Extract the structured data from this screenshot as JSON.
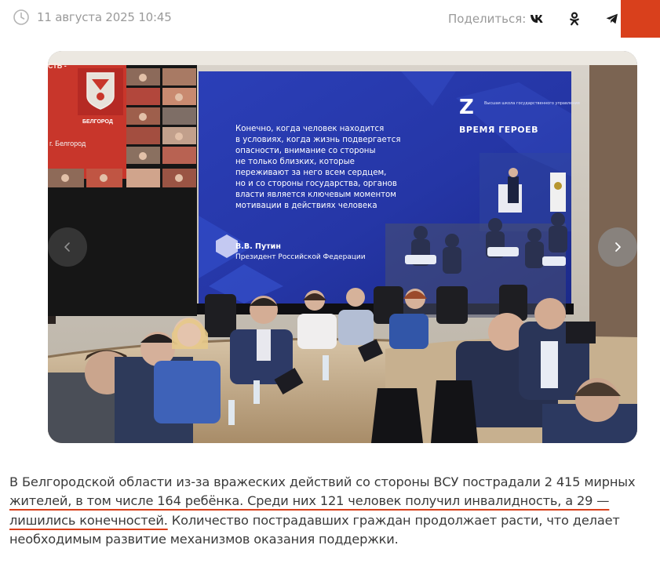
{
  "meta": {
    "date": "11 августа 2025 10:45",
    "share_label": "Поделиться:"
  },
  "share": {
    "buttons": [
      {
        "name": "vk-icon",
        "network": "VK"
      },
      {
        "name": "odnoklassniki-icon",
        "network": "OK"
      },
      {
        "name": "telegram-icon",
        "network": "Telegram"
      }
    ],
    "accent_color": "#d9401c"
  },
  "photo": {
    "screen": {
      "quote_lines": [
        "Конечно, когда человек находится",
        "в условиях, когда жизнь подвергается",
        "опасности, внимание со стороны",
        "не только близких, которые",
        "переживают за него всем сердцем,",
        "но и со стороны государства, органов",
        "власти является ключевым моментом",
        "мотивации в действиях человека"
      ],
      "author_name": "В.В. Путин",
      "author_title": "Президент Российской Федерации",
      "program_title": "ВРЕМЯ ГЕРОЕВ",
      "program_subtitle": "Высшая школа государственного управления",
      "left_panel_label": "г. Белгород",
      "left_panel_brand": "БЕЛГОРОД",
      "left_panel_partial_title": "СТЬ -"
    }
  },
  "article": {
    "text_before": "В Белгородской области из-за вражеских действий со стороны ВСУ пострадали 2 415 мирных ",
    "text_highlight": "жителей, в том числе 164 ребёнка. Среди них 121 человек получил инвалидность, а 29 — лишились конечностей.",
    "text_after": " Количество пострадавших граждан продолжает расти, что делает необходимым развитие механизмов оказания поддержки."
  }
}
